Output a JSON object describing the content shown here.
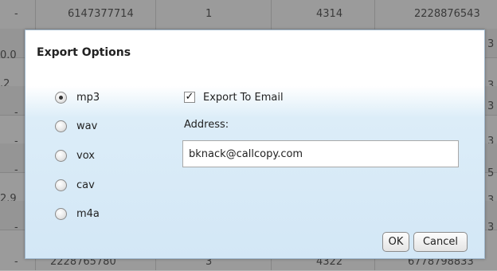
{
  "background": {
    "rows": [
      [
        "-",
        "6147377714",
        "1",
        "4314",
        "2228876543"
      ],
      [
        "0.0",
        "",
        "",
        "",
        "3"
      ],
      [
        ".2",
        "",
        "",
        "",
        "3"
      ],
      [
        "-",
        "",
        "",
        "",
        "3"
      ],
      [
        "-",
        "",
        "",
        "",
        "3"
      ],
      [
        "-",
        "",
        "",
        "",
        "5"
      ],
      [
        "2.9",
        "",
        "",
        "",
        "3"
      ],
      [
        "-",
        "",
        "",
        "",
        "3"
      ],
      [
        "-",
        "2228765780",
        "3",
        "4322",
        "6778798833"
      ]
    ]
  },
  "dialog": {
    "title": "Export Options",
    "formats": [
      {
        "label": "mp3",
        "checked": true
      },
      {
        "label": "wav",
        "checked": false
      },
      {
        "label": "vox",
        "checked": false
      },
      {
        "label": "cav",
        "checked": false
      },
      {
        "label": "m4a",
        "checked": false
      }
    ],
    "export_to_email_label": "Export To Email",
    "export_to_email_checked": true,
    "checkmark": "✓",
    "address_label": "Address:",
    "address_value": "bknack@callcopy.com",
    "ok_label": "OK",
    "cancel_label": "Cancel"
  }
}
